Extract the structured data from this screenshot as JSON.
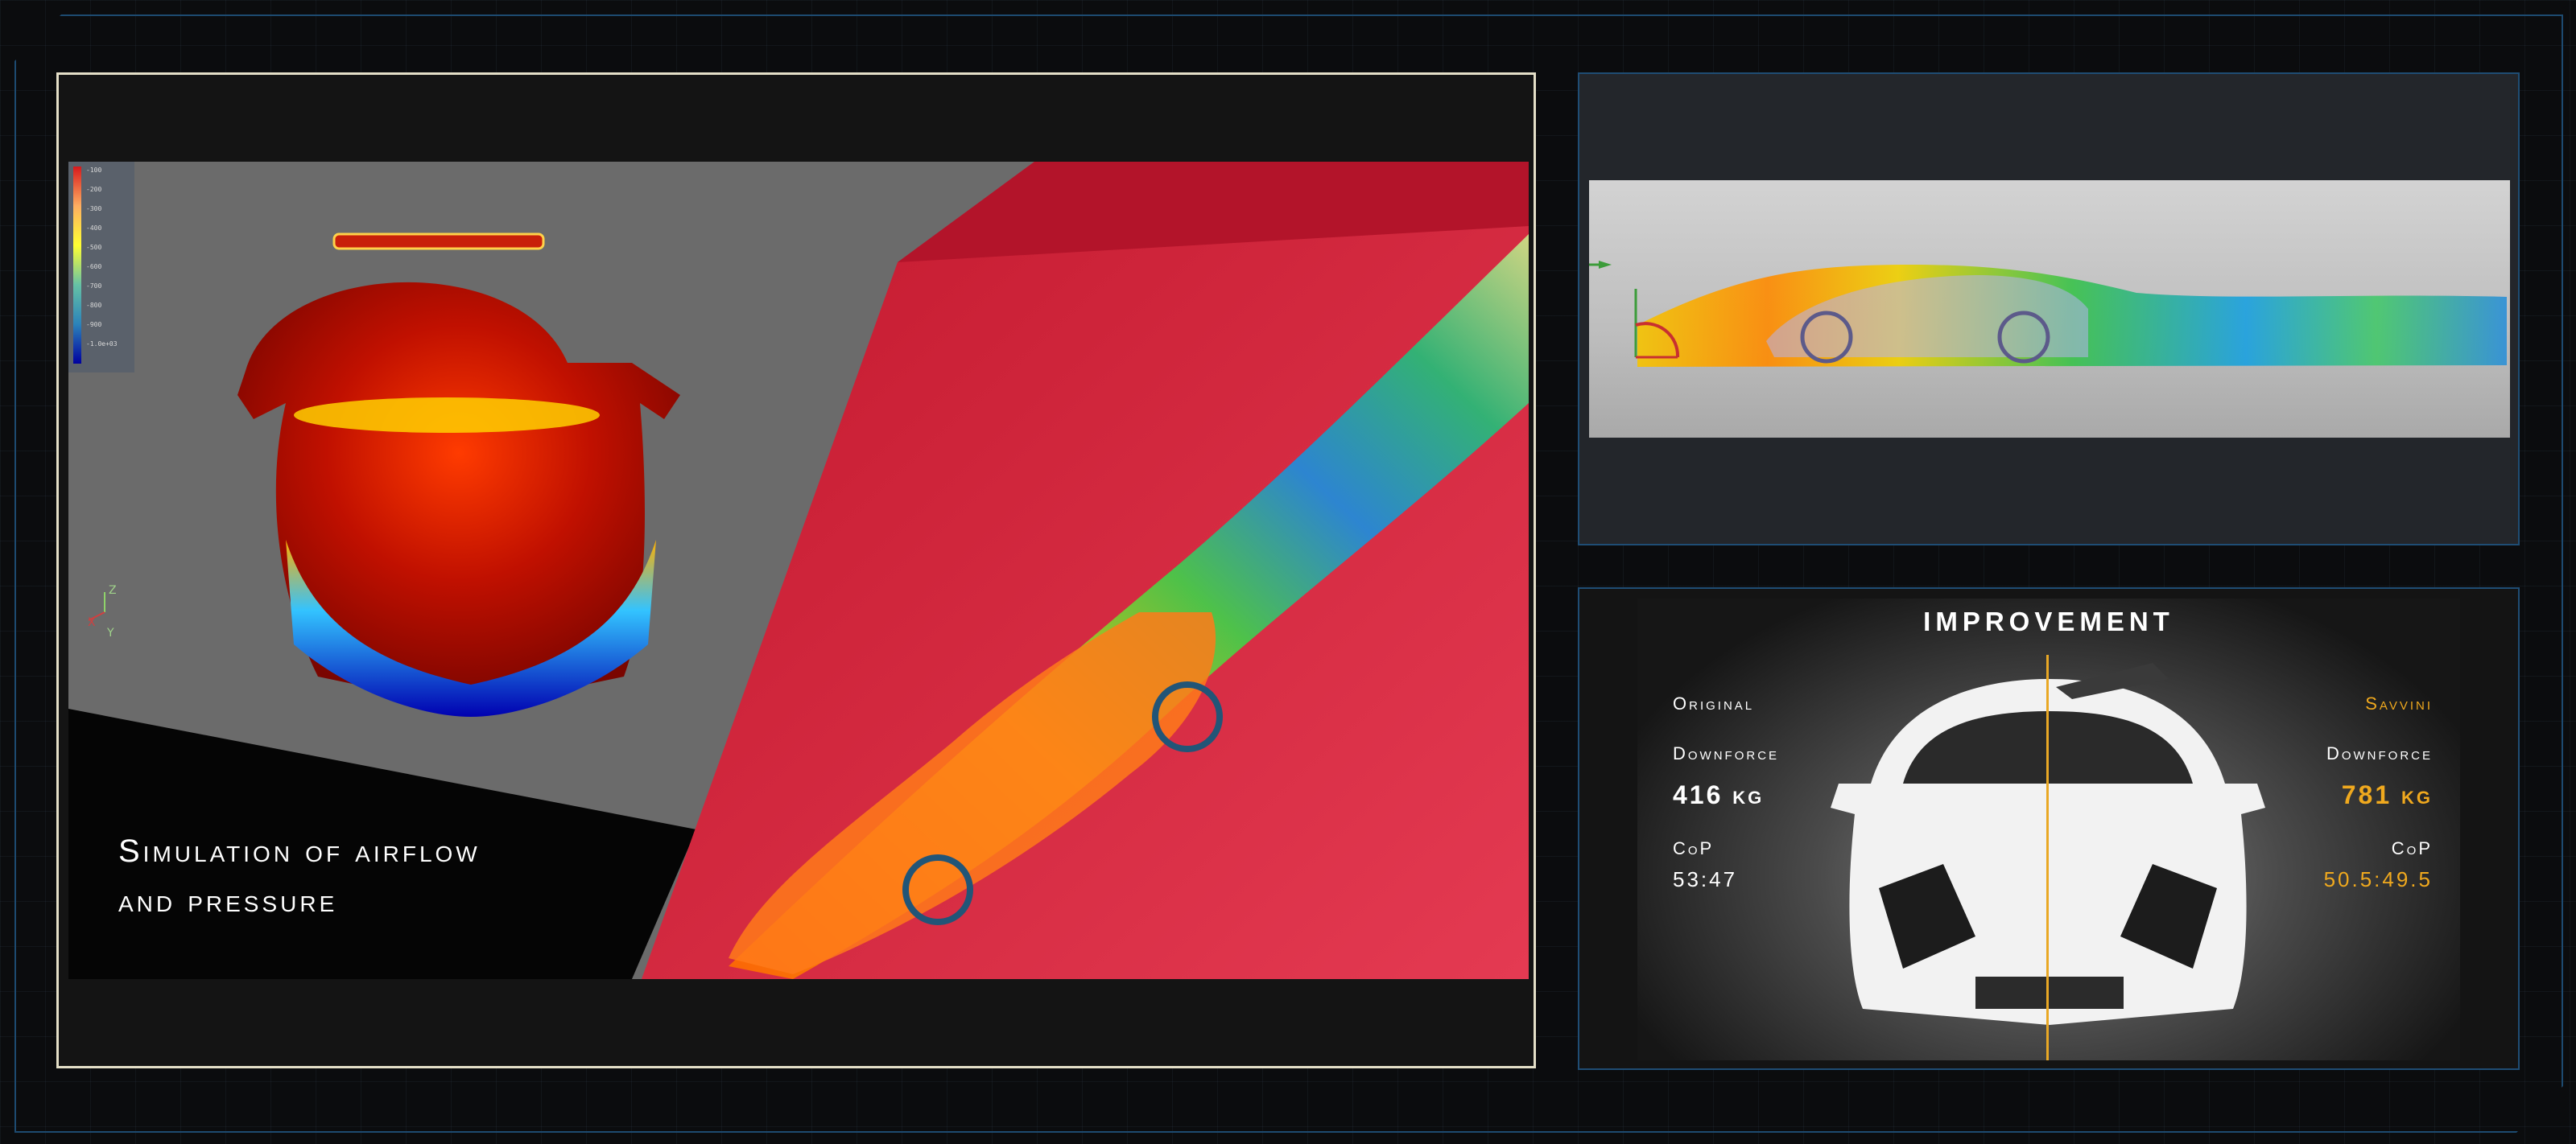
{
  "simulation": {
    "caption_line1": "Simulation of airflow",
    "caption_line2": "and pressure",
    "axis_z": "Z",
    "axis_x": "X",
    "axis_y": "Y",
    "legend_ticks": [
      "-100",
      "-200",
      "-300",
      "-400",
      "-500",
      "-600",
      "-700",
      "-800",
      "-900",
      "-1.0e+03"
    ]
  },
  "improvement": {
    "title": "IMPROVEMENT",
    "original": {
      "label": "Original",
      "downforce_label": "Downforce",
      "downforce_value": "416 kg",
      "cop_label": "CoP",
      "cop_value": "53:47"
    },
    "savvini": {
      "label": "Savvini",
      "downforce_label": "Downforce",
      "downforce_value": "781 kg",
      "cop_label": "CoP",
      "cop_value": "50.5:49.5"
    },
    "accent_color": "#f0a91e"
  }
}
